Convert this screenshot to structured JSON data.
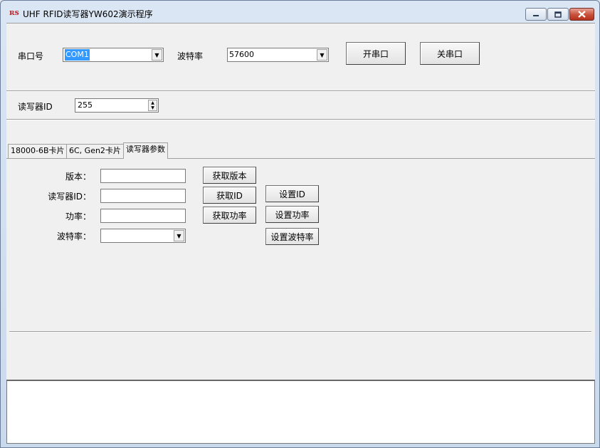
{
  "window": {
    "title": "UHF RFID读写器YW602演示程序",
    "icon_text": "ʀs"
  },
  "titlebar_buttons": {
    "minimize": "minimize-icon",
    "maximize": "maximize-icon",
    "close": "close-icon"
  },
  "serial": {
    "port_label": "串口号",
    "port_value": "COM1",
    "baud_label": "波特率",
    "baud_value": "57600",
    "open_button": "开串口",
    "close_button": "关串口"
  },
  "reader_id": {
    "label": "读写器ID",
    "value": "255"
  },
  "tabs": [
    {
      "label": "18000-6B卡片"
    },
    {
      "label": "6C, Gen2卡片"
    },
    {
      "label": "读写器参数"
    }
  ],
  "params": {
    "version_label": "版本：",
    "reader_id_label": "读写器ID：",
    "power_label": "功率：",
    "baud_label": "波特率：",
    "version_value": "",
    "reader_id_value": "",
    "power_value": "",
    "baud_value": "",
    "get_version": "获取版本",
    "get_id": "获取ID",
    "get_power": "获取功率",
    "set_id": "设置ID",
    "set_power": "设置功率",
    "set_baud": "设置波特率"
  },
  "log": {
    "text": ""
  },
  "colors": {
    "selection": "#3399ff",
    "close_button": "#c7503a",
    "client_bg": "#f0f0f0"
  }
}
